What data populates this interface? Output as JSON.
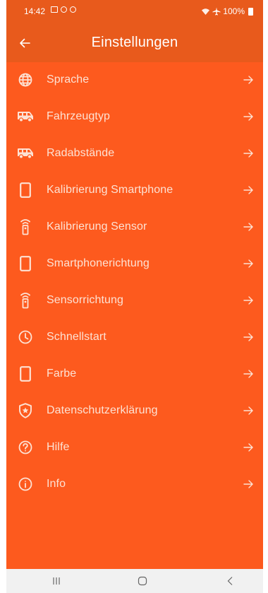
{
  "status_bar": {
    "time": "14:42",
    "battery": "100%",
    "notification_icons": [
      "gallery-icon",
      "circle-badge-icon",
      "circle-badge-icon"
    ],
    "system_icons": [
      "wifi-icon",
      "airplane-icon",
      "battery-icon"
    ]
  },
  "app_bar": {
    "title": "Einstellungen",
    "back_icon": "arrow-left-icon"
  },
  "colors": {
    "app_bar": "#e85a1c",
    "content_background": "#fd5a1e",
    "text": "#fde2d4",
    "nav_bar": "#f1f1f1"
  },
  "menu": {
    "items": [
      {
        "label": "Sprache",
        "icon": "globe-icon"
      },
      {
        "label": "Fahrzeugtyp",
        "icon": "vehicle-icon"
      },
      {
        "label": "Radabstände",
        "icon": "vehicle-icon"
      },
      {
        "label": "Kalibrierung Smartphone",
        "icon": "smartphone-icon"
      },
      {
        "label": "Kalibrierung Sensor",
        "icon": "sensor-icon"
      },
      {
        "label": "Smartphonerichtung",
        "icon": "smartphone-icon"
      },
      {
        "label": "Sensorrichtung",
        "icon": "sensor-icon"
      },
      {
        "label": "Schnellstart",
        "icon": "clock-icon"
      },
      {
        "label": "Farbe",
        "icon": "smartphone-icon"
      },
      {
        "label": "Datenschutzerklärung",
        "icon": "shield-star-icon"
      },
      {
        "label": "Hilfe",
        "icon": "help-circle-icon"
      },
      {
        "label": "Info",
        "icon": "info-circle-icon"
      }
    ],
    "arrow_icon": "arrow-right-icon"
  },
  "nav_bar": {
    "buttons": [
      "recents-icon",
      "home-icon",
      "back-icon"
    ]
  }
}
